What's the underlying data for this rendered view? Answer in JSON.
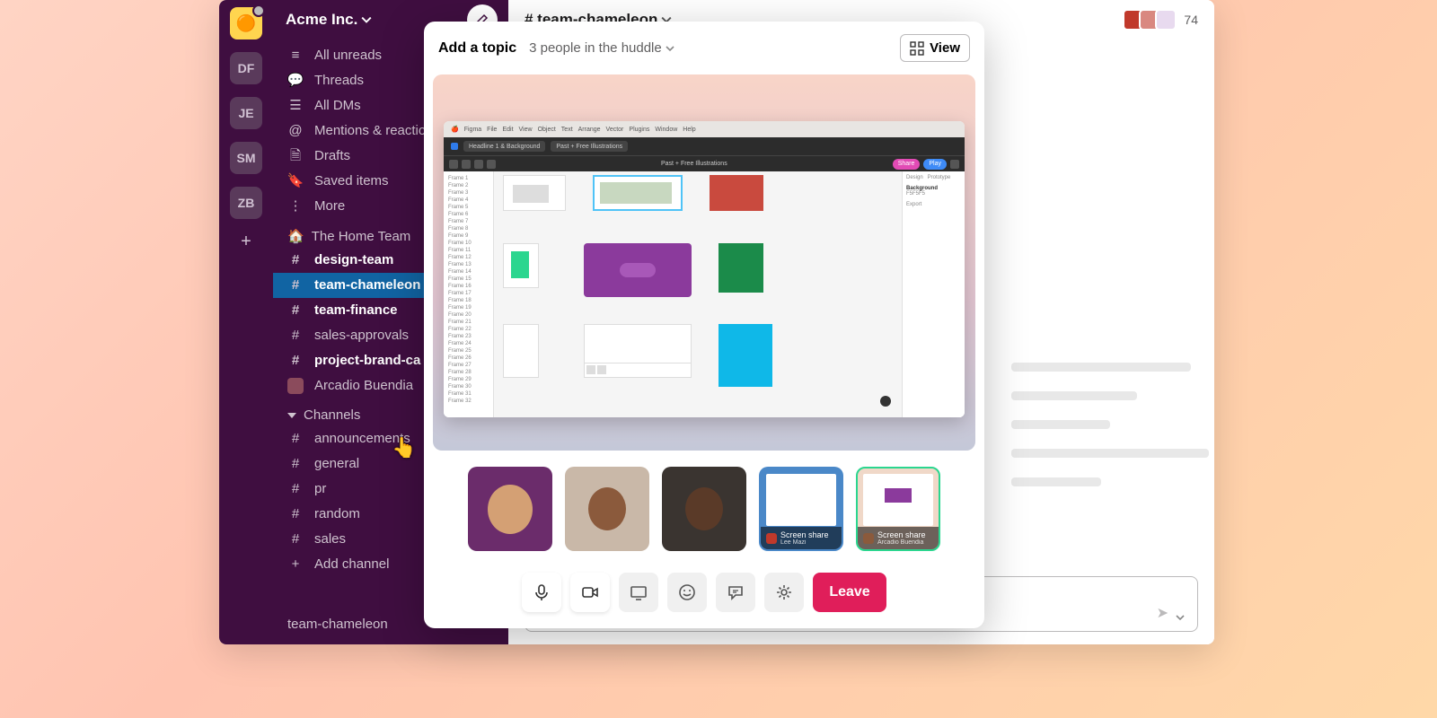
{
  "workspace": {
    "name": "Acme Inc."
  },
  "rail": {
    "initials": [
      "DF",
      "JE",
      "SM",
      "ZB"
    ]
  },
  "nav": {
    "all_unreads": "All unreads",
    "threads": "Threads",
    "all_dms": "All DMs",
    "mentions": "Mentions & reactions",
    "drafts": "Drafts",
    "saved": "Saved items",
    "more": "More"
  },
  "sections": {
    "home_team": {
      "label": "The Home Team",
      "items": [
        {
          "name": "design-team",
          "bold": true
        },
        {
          "name": "team-chameleon",
          "active": true
        },
        {
          "name": "team-finance",
          "bold": true
        },
        {
          "name": "sales-approvals"
        },
        {
          "name": "project-brand-ca",
          "bold": true
        },
        {
          "name": "Arcadio Buendia",
          "person": true
        }
      ]
    },
    "channels": {
      "label": "Channels",
      "items": [
        {
          "name": "announcements"
        },
        {
          "name": "general"
        },
        {
          "name": "pr"
        },
        {
          "name": "random"
        },
        {
          "name": "sales"
        }
      ],
      "add": "Add channel"
    }
  },
  "footer_mini": "team-chameleon",
  "channel": {
    "name": "# team-chameleon",
    "members": "74"
  },
  "huddle": {
    "topic": "Add a topic",
    "subtitle": "3 people in the huddle",
    "view": "View",
    "leave": "Leave",
    "screen_share_label": "Screen share",
    "presenters": [
      "Lee Mazi",
      "Arcadio Buendia"
    ]
  },
  "figma": {
    "app": "Figma",
    "tab1": "Headline 1 & Background",
    "tab2": "Past + Free Illustrations",
    "center": "Past + Free Illustrations",
    "btn1": "Share",
    "btn2": "Play"
  },
  "mac_menu": [
    "Figma",
    "File",
    "Edit",
    "View",
    "Object",
    "Text",
    "Arrange",
    "Vector",
    "Plugins",
    "Window",
    "Help"
  ]
}
